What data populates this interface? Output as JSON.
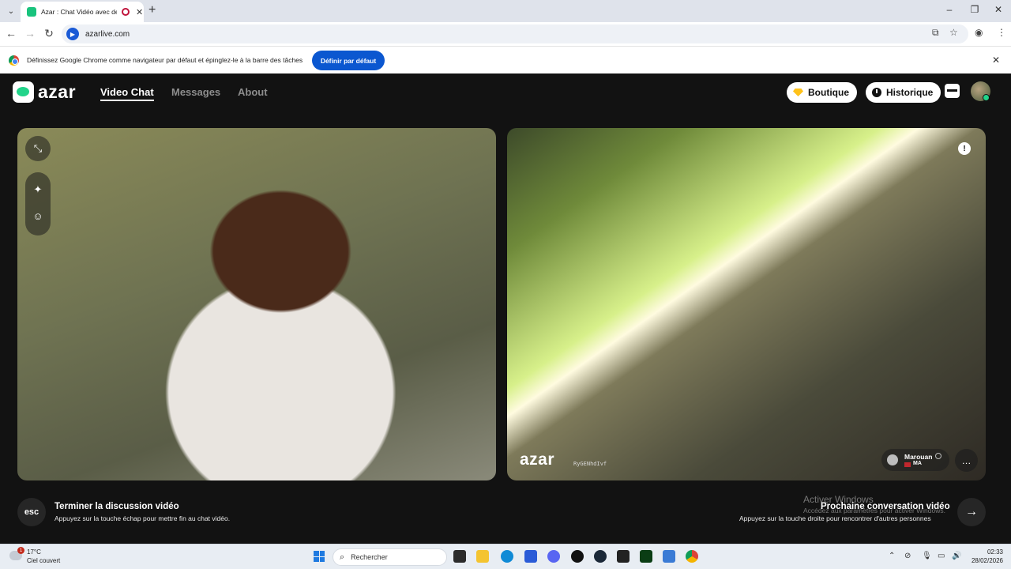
{
  "browser": {
    "tab_title": "Azar : Chat Vidéo avec de n",
    "tab_close": "✕",
    "new_tab": "+",
    "url": "azarlive.com",
    "infobar_text": "Définissez Google Chrome comme navigateur par défaut et épinglez-le à la barre des tâches",
    "infobar_button": "Définir par défaut",
    "infobar_close": "✕"
  },
  "app": {
    "logo_text": "azar",
    "nav": [
      "Video Chat",
      "Messages",
      "About"
    ],
    "boutique_label": "Boutique",
    "historique_label": "Historique",
    "accent_color": "#22d48a"
  },
  "remote": {
    "watermark": "azar",
    "session_id": "RyGENhdIvf",
    "user_name": "Marouan",
    "country": "MA"
  },
  "bottom": {
    "end_key": "esc",
    "end_title": "Terminer la discussion vidéo",
    "end_sub": "Appuyez sur la touche échap pour mettre fin au chat vidéo.",
    "next_title": "Prochaine conversation vidéo",
    "next_sub": "Appuyez sur la touche droite pour rencontrer d'autres personnes",
    "next_arrow": "→"
  },
  "watermark_windows": {
    "line1": "Activer Windows",
    "line2": "Accédez aux paramètres pour activer Windows."
  },
  "taskbar": {
    "weather_badge": "1",
    "temperature": "17°C",
    "weather_desc": "Ciel couvert",
    "search_placeholder": "Rechercher",
    "time": "02:33",
    "date": "28/02/2026"
  }
}
